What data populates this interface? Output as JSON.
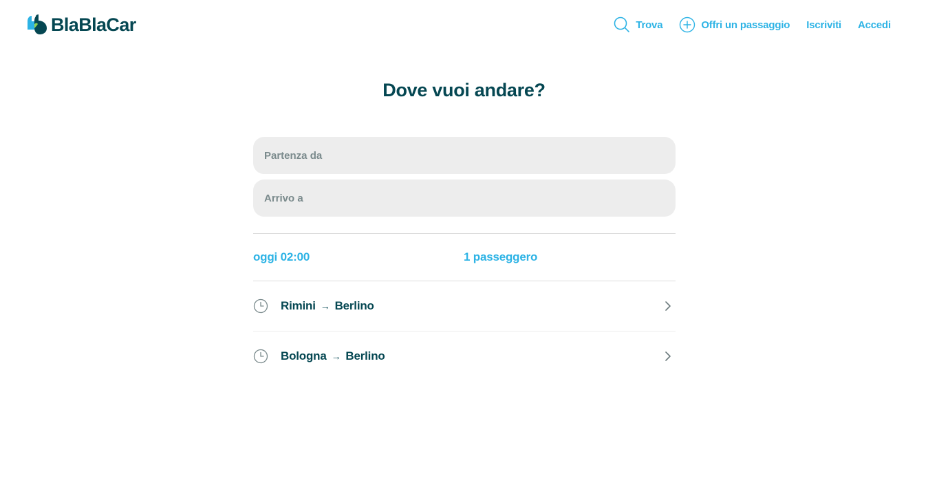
{
  "brand": {
    "name": "BlaBlaCar",
    "primary": "#2db3e5",
    "dark": "#054752"
  },
  "nav": {
    "find_label": "Trova",
    "offer_label": "Offri un passaggio",
    "signup_label": "Iscriviti",
    "login_label": "Accedi"
  },
  "search": {
    "title": "Dove vuoi andare?",
    "from_placeholder": "Partenza da",
    "to_placeholder": "Arrivo a",
    "date_label": "oggi 02:00",
    "passengers_label": "1 passeggero"
  },
  "recent_searches": [
    {
      "from": "Rimini",
      "to": "Berlino",
      "icon": "clock-icon"
    },
    {
      "from": "Bologna",
      "to": "Berlino",
      "icon": "clock-icon"
    }
  ],
  "arrow_glyph": "→"
}
